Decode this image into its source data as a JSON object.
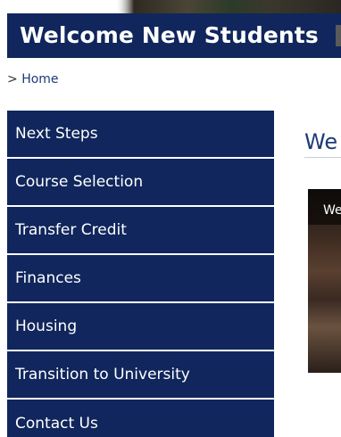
{
  "header": {
    "title": "Welcome New Students"
  },
  "breadcrumb": {
    "separator": ">",
    "home_label": "Home"
  },
  "sidebar": {
    "items": [
      {
        "label": "Next Steps"
      },
      {
        "label": "Course Selection"
      },
      {
        "label": "Transfer Credit"
      },
      {
        "label": "Finances"
      },
      {
        "label": "Housing"
      },
      {
        "label": "Transition to University"
      },
      {
        "label": "Contact Us"
      }
    ]
  },
  "main": {
    "heading": "We",
    "video_title": "We"
  },
  "colors": {
    "nav_background": "#10265c",
    "link": "#1d3a78",
    "nav_text": "#ffffff"
  }
}
